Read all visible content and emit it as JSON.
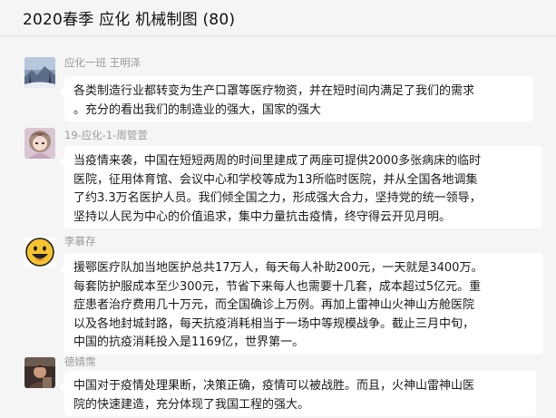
{
  "window": {
    "title": "2020春季 应化  机械制图 (80)"
  },
  "messages": [
    {
      "sender": "应化一班 王明泽",
      "avatar_icon": "snowy-winter-avatar",
      "lines": [
        "各类制造行业都转变为生产口罩等医疗物资，并在短时间内满足了我们的需求",
        "。充分的看出我们的制造业的强大，国家的强大"
      ]
    },
    {
      "sender": "19-应化-1-周管萱",
      "avatar_icon": "anime-girl-avatar",
      "lines": [
        "当疫情来袭，中国在短短两周的时间里建成了两座可提供2000多张病床的临时",
        "医院，征用体育馆、会议中心和学校等成为13所临时医院，并从全国各地调集",
        "了约3.3万名医护人员。我们倾全国之力，形成强大合力，坚持党的统一领导，",
        "坚持以人民为中心的价值追求，集中力量抗击疫情，终守得云开见月明。"
      ]
    },
    {
      "sender": "李慕存",
      "avatar_icon": "smiley-face-avatar",
      "lines": [
        "援鄂医疗队加当地医护总共17万人，每天每人补助200元，一天就是3400万。",
        "每套防护服成本至少300元，节省下来每人也需要十几套，成本超过5亿元。重",
        "症患者治疗费用几十万元，而全国确诊上万例。再加上雷神山火神山方舱医院",
        "以及各地封城封路，每天抗疫消耗相当于一场中等规模战争。截止三月中旬，",
        "中国的抗疫消耗投入是1169亿，世界第一。"
      ]
    },
    {
      "sender": "德婧霈",
      "avatar_icon": "dark-portrait-avatar",
      "lines": [
        "中国对于疫情处理果断，决策正确，疫情可以被战胜。而且，火神山雷神山医",
        "院的快速建造，充分体现了我国工程的强大。"
      ]
    }
  ]
}
